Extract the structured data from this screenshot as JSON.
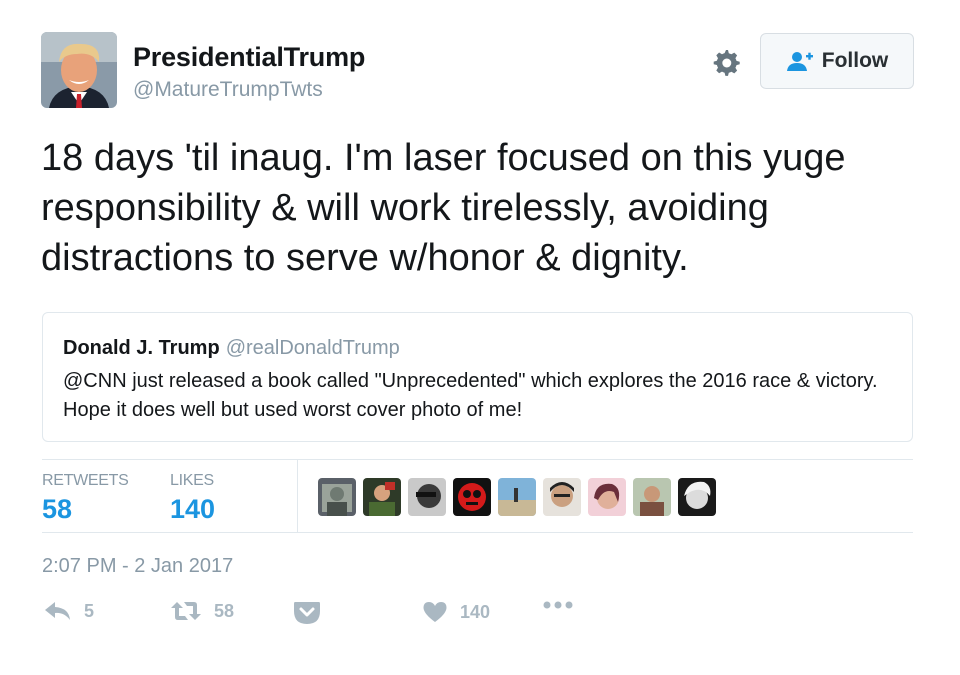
{
  "user": {
    "display_name": "PresidentialTrump",
    "handle": "@MatureTrumpTwts",
    "follow_label": "Follow"
  },
  "tweet": {
    "text": "18 days 'til inaug. I'm laser focused on this yuge responsibility & will work tirelessly, avoiding distractions to serve w/honor & dignity."
  },
  "quoted": {
    "name": "Donald J. Trump",
    "handle": "@realDonaldTrump",
    "text": "@CNN just released a book called \"Unprecedented\" which explores the 2016 race & victory. Hope it does well but used worst cover photo of me!"
  },
  "stats": {
    "retweets_label": "RETWEETS",
    "retweets_value": "58",
    "likes_label": "LIKES",
    "likes_value": "140",
    "liker_avatars": 9
  },
  "timestamp": "2:07 PM - 2 Jan 2017",
  "actions": {
    "reply_count": "5",
    "retweet_count": "58",
    "like_count": "140"
  },
  "colors": {
    "accent": "#1b95e0",
    "muted": "#8899a6",
    "icon": "#aab8c2",
    "border": "#e1e8ed"
  },
  "icons": [
    "settings-gear-icon",
    "follow-person-plus-icon",
    "reply-icon",
    "retweet-icon",
    "pocket-save-icon",
    "heart-icon",
    "more-dots-icon"
  ]
}
